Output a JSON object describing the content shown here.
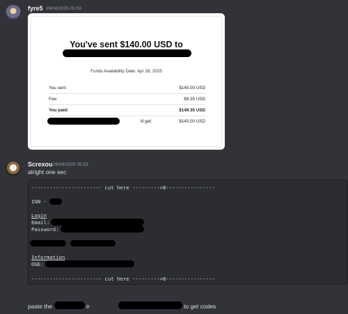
{
  "messages": [
    {
      "username": "fyre5",
      "timestamp": "28/04/2025 05:53",
      "receipt": {
        "title": "You've sent $140.00 USD to",
        "availability": "Funds Availability Date: Apr 28, 2025",
        "rows": [
          {
            "label": "You sent:",
            "value": "$140.00 USD"
          },
          {
            "label": "Fee:",
            "value": "$9.35 USD"
          },
          {
            "label": "You paid:",
            "value": "$149.35 USD"
          },
          {
            "label": "ill get:",
            "value": "$140.00 USD"
          }
        ]
      }
    },
    {
      "username": "Screxou",
      "timestamp": "28/04/2025 05:53",
      "text": "alright one sec",
      "code": {
        "cut_line": "----------------------- cut here --------->8----------------",
        "ign": "IGN -",
        "login_header": "Login",
        "email": "Email:",
        "password": "Password:",
        "info_header": "Information",
        "oge": "OGE:"
      }
    }
  ],
  "last_message": {
    "part1": "paste the",
    "part2": "ir",
    "part3": "to get codes"
  }
}
